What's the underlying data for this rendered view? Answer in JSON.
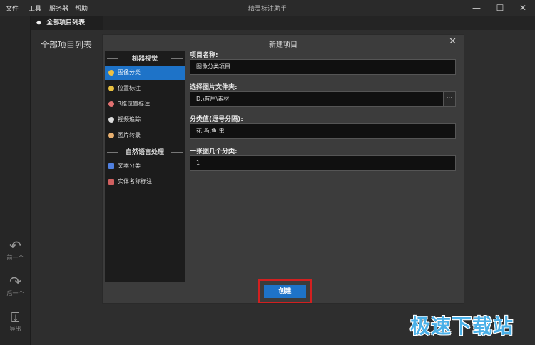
{
  "menu": {
    "file": "文件",
    "tools": "工具",
    "server": "服务器",
    "help": "帮助"
  },
  "app_title": "精灵标注助手",
  "window_buttons": {
    "minimize": "—",
    "maximize": "☐",
    "close": "✕"
  },
  "left_nav": {
    "prev_label": "前一个",
    "next_label": "后一个",
    "export_label": "导出"
  },
  "tab": {
    "icon": "diamond-icon",
    "label": "全部项目列表"
  },
  "page_heading": "全部项目列表",
  "dialog": {
    "title": "新建项目",
    "close": "✕",
    "categories": {
      "group1": "机器视觉",
      "group1_items": [
        {
          "label": "图像分类",
          "icon": "image-class-icon"
        },
        {
          "label": "位置标注",
          "icon": "position-icon"
        },
        {
          "label": "3维位置标注",
          "icon": "3d-position-icon"
        },
        {
          "label": "视频追踪",
          "icon": "video-track-icon"
        },
        {
          "label": "图片转录",
          "icon": "transcribe-icon"
        }
      ],
      "group2": "自然语言处理",
      "group2_items": [
        {
          "label": "文本分类",
          "icon": "text-class-icon"
        },
        {
          "label": "实体名称标注",
          "icon": "entity-icon"
        }
      ]
    },
    "form": {
      "project_name_label": "项目名称:",
      "project_name_value": "图像分类项目",
      "folder_label": "选择图片文件夹:",
      "folder_value": "D:\\有用\\素材",
      "browse_label": "···",
      "classes_label": "分类值(逗号分隔):",
      "classes_value": "花,鸟,鱼,虫",
      "per_image_label": "一张图几个分类:",
      "per_image_value": "1"
    },
    "create_label": "创建"
  },
  "watermark": "极速下载站",
  "colors": {
    "accent": "#1e73c8",
    "highlight": "#d22020"
  }
}
